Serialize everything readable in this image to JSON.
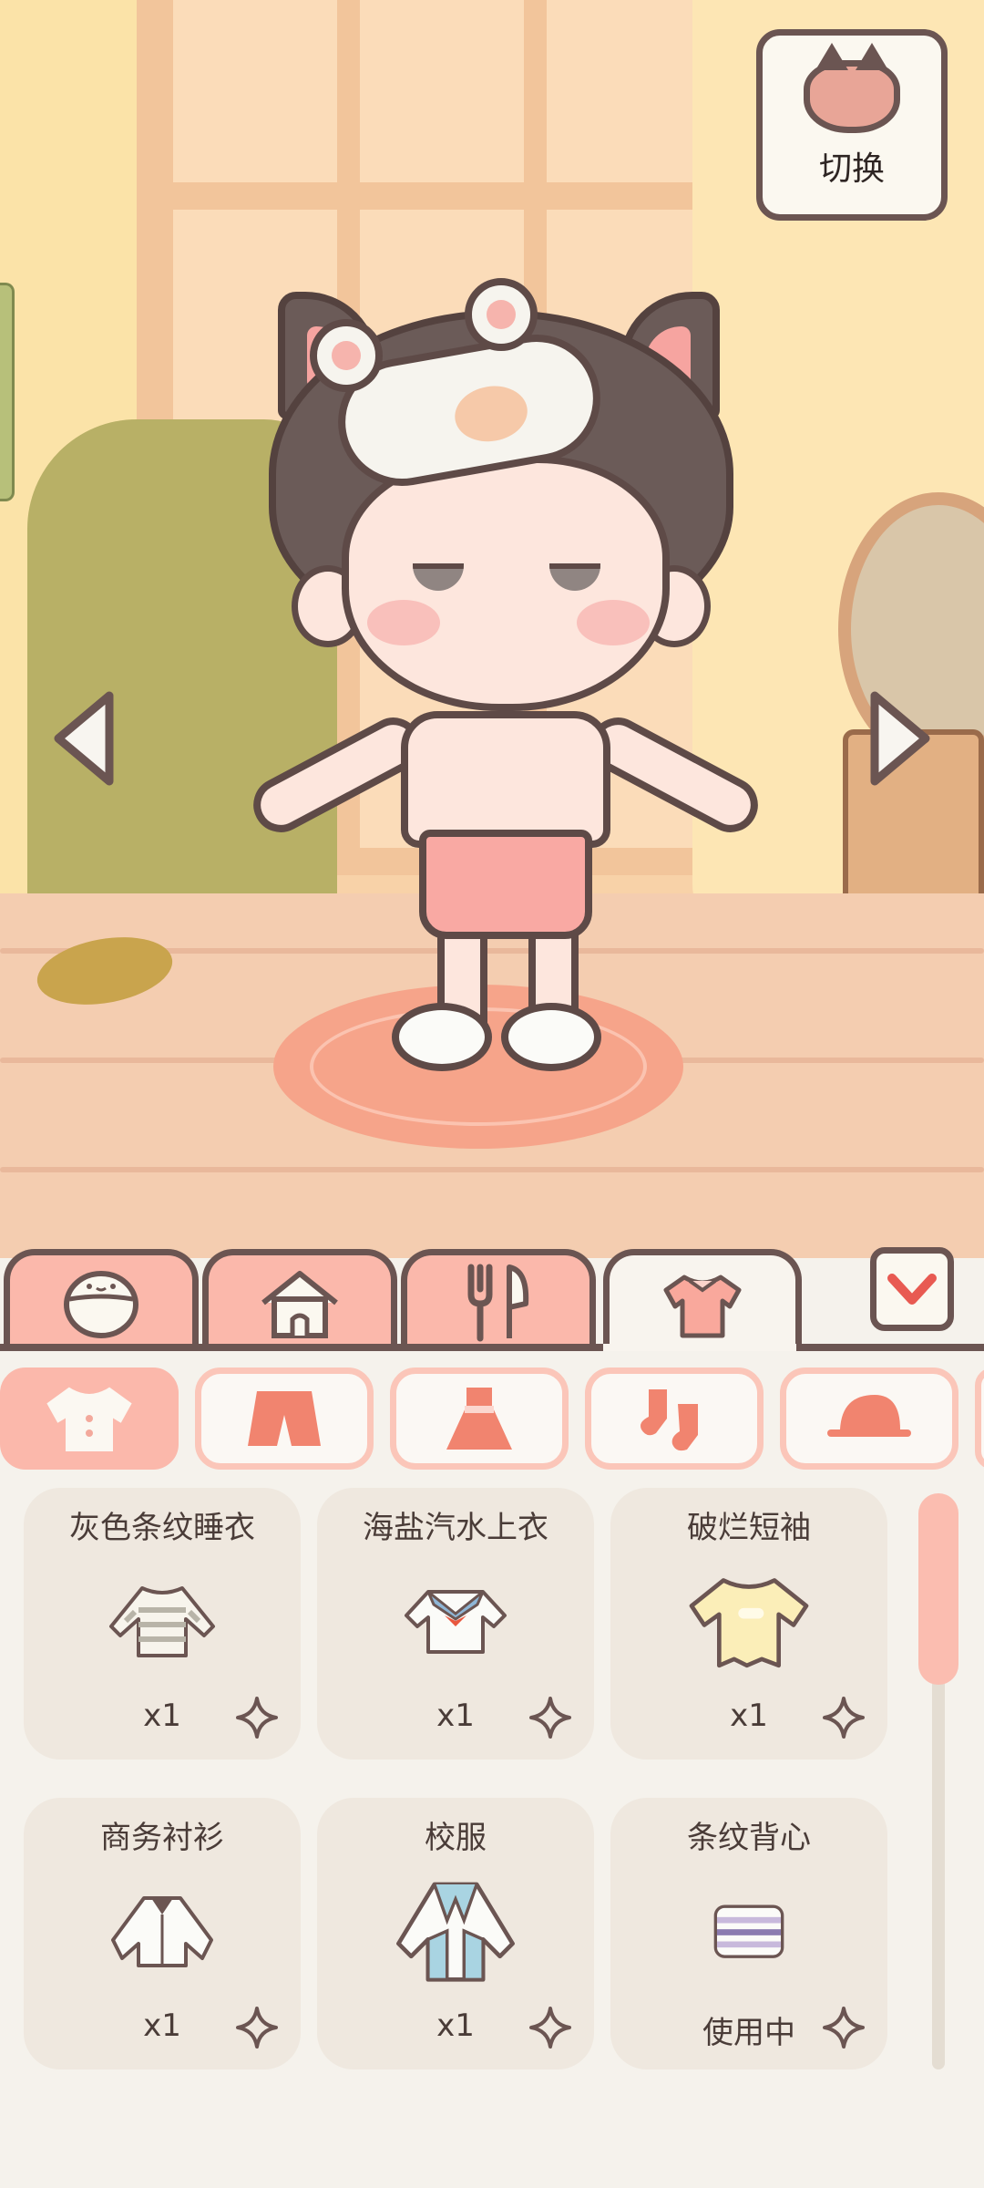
{
  "scene": {
    "switch_label": "切换"
  },
  "main_tabs": [
    {
      "icon": "face-icon",
      "active": false
    },
    {
      "icon": "house-icon",
      "active": false
    },
    {
      "icon": "utensils-icon",
      "active": false
    },
    {
      "icon": "shirt-icon",
      "active": true
    }
  ],
  "sub_categories": [
    {
      "icon": "top-icon",
      "active": true
    },
    {
      "icon": "shorts-icon",
      "active": false
    },
    {
      "icon": "dress-icon",
      "active": false
    },
    {
      "icon": "socks-icon",
      "active": false
    },
    {
      "icon": "cap-icon",
      "active": false
    }
  ],
  "items": [
    {
      "name": "灰色条纹睡衣",
      "count": "x1",
      "icon": "striped-sweater-icon"
    },
    {
      "name": "海盐汽水上衣",
      "count": "x1",
      "icon": "sailor-top-icon"
    },
    {
      "name": "破烂短袖",
      "count": "x1",
      "icon": "torn-tshirt-icon"
    },
    {
      "name": "商务衬衫",
      "count": "x1",
      "icon": "dress-shirt-icon"
    },
    {
      "name": "校服",
      "count": "x1",
      "icon": "school-uniform-icon"
    },
    {
      "name": "条纹背心",
      "count": "使用中",
      "icon": "striped-vest-icon"
    }
  ],
  "colors": {
    "accent": "#fbb8ab",
    "outline": "#6b5552",
    "card_bg": "#efe8df",
    "panel_bg": "#f5f2ec"
  }
}
